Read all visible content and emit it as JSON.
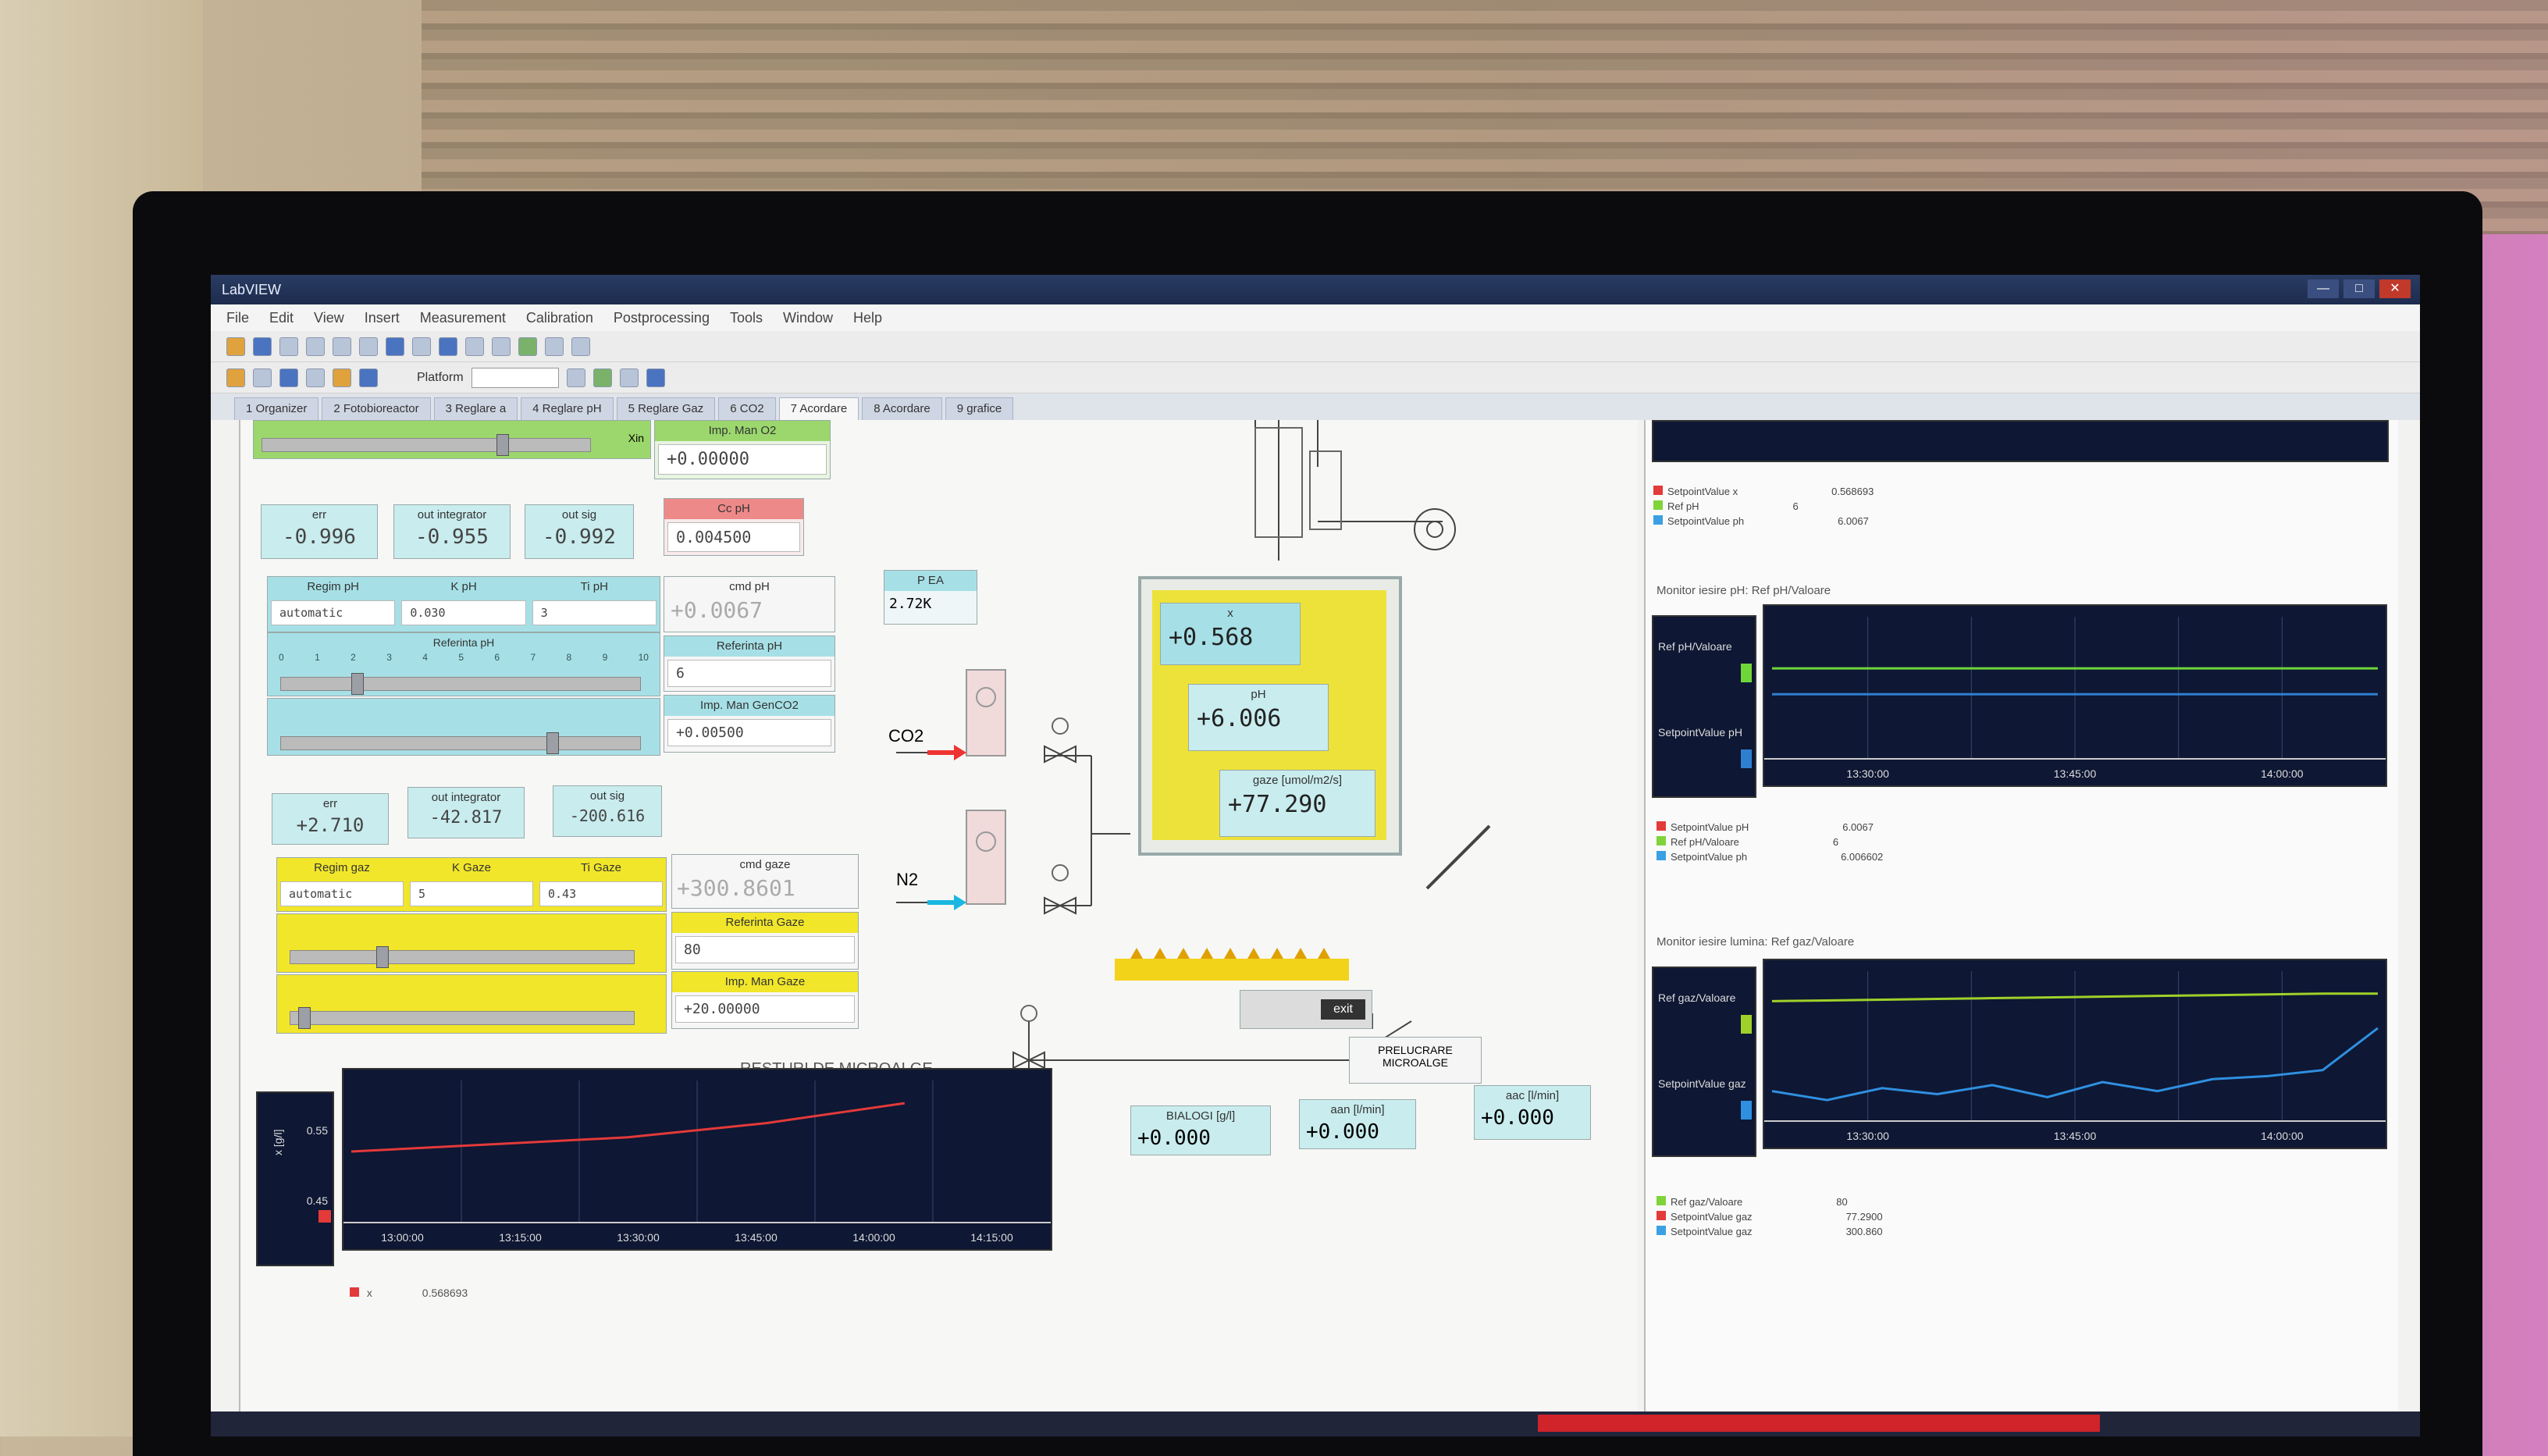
{
  "window": {
    "title": "LabVIEW",
    "buttons": [
      "—",
      "□",
      "✕"
    ]
  },
  "menu": [
    "File",
    "Edit",
    "View",
    "Insert",
    "Measurement",
    "Calibration",
    "Postprocessing",
    "Tools",
    "Window",
    "Help"
  ],
  "toolbar": {
    "platform_label": "Platform"
  },
  "tabs": [
    "1 Organizer",
    "2 Fotobioreactor",
    "3 Reglare a",
    "4 Reglare pH",
    "5 Reglare Gaz",
    "6 CO2",
    "7 Acordare",
    "8 Acordare",
    "9 grafice"
  ],
  "active_tab": 6,
  "green_block": {
    "imp_label": "Imp. Man O2",
    "imp_value": "+0.00000",
    "x_label": "Xin"
  },
  "pid1": {
    "err_label": "err",
    "err": "-0.996",
    "integrator_label": "out integrator",
    "integrator": "-0.955",
    "integ_label": "out sig",
    "integ": "-0.992",
    "cc_label": "Cc pH",
    "cc_value": "0.004500"
  },
  "ph_controls": {
    "alg_label": "Regim pH",
    "alg_value": "automatic",
    "kp_label": "K pH",
    "kp_value": "0.030",
    "ti_label": "Ti pH",
    "ti_value": "3",
    "cmd_label": "cmd pH",
    "cmd_value": "+0.0067",
    "ref_label": "Referinta pH",
    "ref_value": "6",
    "imp_label": "Imp. Man GenCO2",
    "imp_value": "+0.00500",
    "scale": [
      "0",
      "1",
      "2",
      "3",
      "4",
      "5",
      "6",
      "7",
      "8",
      "9",
      "10"
    ],
    "slider_label": "Referinta pH"
  },
  "peak": {
    "label": "P EA",
    "value": "2.72K"
  },
  "pid2": {
    "err_label": "err",
    "err": "+2.710",
    "integrator_label": "out integrator",
    "integrator": "-42.817",
    "integ_label": "out sig",
    "integ": "-200.616"
  },
  "gas_controls": {
    "alg_label": "Regim gaz",
    "alg_value": "automatic",
    "kp_label": "K Gaze",
    "kp_value": "5",
    "ti_label": "Ti Gaze",
    "ti_value": "0.43",
    "cmd_label": "cmd gaze",
    "cmd_value": "+300.8601",
    "ref_label": "Referinta Gaze",
    "ref_value": "80",
    "imp_label": "Imp. Man Gaze",
    "imp_value": "+20.00000"
  },
  "process": {
    "co2_label": "CO2",
    "n2_label": "N2",
    "reactor": {
      "x_label": "x",
      "x_value": "+0.568",
      "ph_label": "pH",
      "ph_value": "+6.006",
      "gas_label": "gaze [umol/m2/s]",
      "gas_value": "+77.290"
    },
    "mini_btn": "exit",
    "prelucrare": "PRELUCRARE MICROALGE",
    "resturi": "RESTURI DE MICROALGE",
    "out1_label": "BIALOGI [g/l]",
    "out1": "+0.000",
    "out2_label": "aan [l/min]",
    "out2": "+0.000",
    "out3_label": "aac [l/min]",
    "out3": "+0.000"
  },
  "bottom_chart": {
    "ylabel": "x [g/l]",
    "yticks": [
      "0.55",
      "0.45"
    ],
    "xticks": [
      "13:00:00",
      "13:15:00",
      "13:30:00",
      "13:45:00",
      "14:00:00",
      "14:15:00"
    ],
    "legend": [
      {
        "name": "x",
        "value": "0.568693",
        "color": "#e33a3a"
      }
    ],
    "chart_data": {
      "type": "line",
      "x": [
        "13:00:00",
        "13:15:00",
        "13:30:00",
        "13:45:00",
        "14:00:00",
        "14:15:00"
      ],
      "series": [
        {
          "name": "x",
          "values": [
            0.5,
            0.51,
            0.52,
            0.54,
            0.568,
            null
          ]
        }
      ],
      "xlabel": "",
      "ylabel": "x [g/l]",
      "ylim": [
        0.4,
        0.6
      ]
    }
  },
  "right_top": {
    "table_rows": [
      {
        "name": "SetpointValue x",
        "value": "0.568693",
        "color": "#e33a3a"
      },
      {
        "name": "Ref pH",
        "value": "6",
        "color": "#7fd43a"
      },
      {
        "name": "SetpointValue ph",
        "value": "6.0067",
        "color": "#3aa0e3"
      }
    ]
  },
  "ph_chart": {
    "title": "Monitor iesire pH: Ref pH/Valoare",
    "legend_side": [
      "Ref pH/Valoare",
      "SetpointValue pH"
    ],
    "xticks": [
      "13:30:00",
      "13:45:00",
      "14:00:00"
    ],
    "table_rows": [
      {
        "name": "SetpointValue pH",
        "value": "6.0067",
        "color": "#e33a3a"
      },
      {
        "name": "Ref pH/Valoare",
        "value": "6",
        "color": "#7fd43a"
      },
      {
        "name": "SetpointValue ph",
        "value": "6.006602",
        "color": "#3aa0e3"
      }
    ],
    "chart_data": {
      "type": "line",
      "x": [
        "13:15:00",
        "13:30:00",
        "13:45:00",
        "14:00:00",
        "14:10:00"
      ],
      "series": [
        {
          "name": "Ref pH/Valoare",
          "values": [
            6.2,
            6.2,
            6.2,
            6.2,
            6.2
          ],
          "color": "#6fd63a"
        },
        {
          "name": "SetpointValue pH",
          "values": [
            6.0,
            6.0,
            6.0,
            6.0,
            6.0
          ],
          "color": "#2f7fd0"
        }
      ],
      "ylim": [
        5.5,
        6.6
      ]
    }
  },
  "gas_chart": {
    "title": "Monitor iesire lumina: Ref gaz/Valoare",
    "legend_side": [
      "Ref gaz/Valoare",
      "SetpointValue gaz"
    ],
    "xticks": [
      "13:30:00",
      "13:45:00",
      "14:00:00"
    ],
    "table_rows": [
      {
        "name": "Ref gaz/Valoare",
        "value": "80",
        "color": "#7fd43a"
      },
      {
        "name": "SetpointValue gaz",
        "value": "77.2900",
        "color": "#e33a3a"
      },
      {
        "name": "SetpointValue gaz",
        "value": "300.860",
        "color": "#3aa0e3"
      }
    ],
    "chart_data": {
      "type": "line",
      "x": [
        "13:15",
        "13:20",
        "13:25",
        "13:30",
        "13:35",
        "13:40",
        "13:45",
        "13:50",
        "13:55",
        "14:00",
        "14:05",
        "14:10"
      ],
      "series": [
        {
          "name": "Ref gaz/Valoare",
          "values": [
            80,
            80.5,
            81,
            81.5,
            82,
            82.5,
            83,
            83.5,
            84,
            84.5,
            85,
            85
          ],
          "color": "#9fd12a"
        },
        {
          "name": "SetpointValue gaz",
          "values": [
            20,
            14,
            22,
            18,
            24,
            16,
            26,
            20,
            28,
            30,
            34,
            62
          ],
          "color": "#2f8fe0"
        }
      ],
      "ylim": [
        0,
        100
      ]
    }
  }
}
